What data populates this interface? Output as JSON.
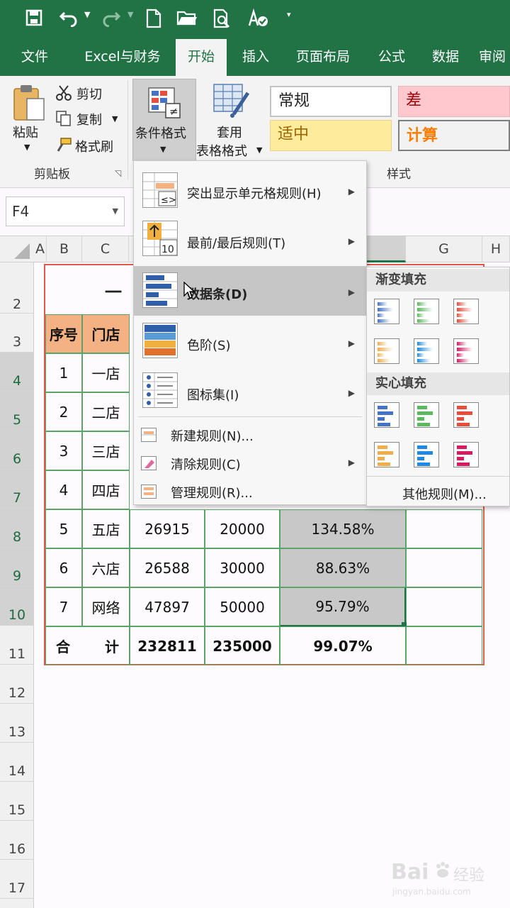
{
  "colors": {
    "brand": "#217346",
    "header_fill": "#f4b183",
    "selected_fill": "#c8c8c8",
    "border_red": "#e05a4a",
    "bad_bg": "#ffc7ce",
    "bad_fg": "#9c0006",
    "neutral_bg": "#ffeb9c",
    "neutral_fg": "#9c6500",
    "calc_fg": "#fa7d00"
  },
  "ribbon_tabs": [
    "文件",
    "Excel与财务",
    "开始",
    "插入",
    "页面布局",
    "公式",
    "数据",
    "审阅"
  ],
  "ribbon": {
    "paste": "粘贴",
    "cut": "剪切",
    "copy": "复制",
    "format_painter": "格式刷",
    "clipboard_group": "剪贴板",
    "conditional_format": "条件格式",
    "table_format_line1": "套用",
    "table_format_line2": "表格格式",
    "styles_group": "样式",
    "style_normal": "常规",
    "style_bad": "差",
    "style_neutral": "适中",
    "style_calc": "计算"
  },
  "name_box": "F4",
  "columns": [
    "A",
    "B",
    "C",
    "G",
    "H"
  ],
  "rows": [
    "2",
    "3",
    "4",
    "5",
    "6",
    "7",
    "8",
    "9",
    "10",
    "11",
    "12",
    "13",
    "14",
    "15",
    "16",
    "17"
  ],
  "sheet": {
    "title_partial": "一",
    "header": [
      "序号",
      "门店"
    ],
    "upper_rows": [
      [
        "1",
        "一店"
      ],
      [
        "2",
        "二店"
      ],
      [
        "3",
        "三店"
      ],
      [
        "4",
        "四店"
      ]
    ],
    "lower_rows": [
      [
        "5",
        "五店",
        "26915",
        "20000",
        "134.58%"
      ],
      [
        "6",
        "六店",
        "26588",
        "30000",
        "88.63%"
      ],
      [
        "7",
        "网络",
        "47897",
        "50000",
        "95.79%"
      ]
    ],
    "total": [
      "合",
      "计",
      "232811",
      "235000",
      "99.07%"
    ]
  },
  "cf_menu": {
    "highlight": "突出显示单元格规则(H)",
    "topbottom": "最前/最后规则(T)",
    "databar": "数据条(D)",
    "colorscale": "色阶(S)",
    "iconset": "图标集(I)",
    "new_rule": "新建规则(N)...",
    "clear_rule": "清除规则(C)",
    "manage_rule": "管理规则(R)..."
  },
  "submenu": {
    "gradient": "渐变填充",
    "solid": "实心填充",
    "more": "其他规则(M)...",
    "bar_colors": [
      "#4472c4",
      "#5cb85c",
      "#e74c3c",
      "#f0ad4e",
      "#1e88e5",
      "#d81b60"
    ]
  },
  "watermark": {
    "brand": "Bai",
    "brand_tail": "经验",
    "url": "jingyan.baidu.com"
  }
}
